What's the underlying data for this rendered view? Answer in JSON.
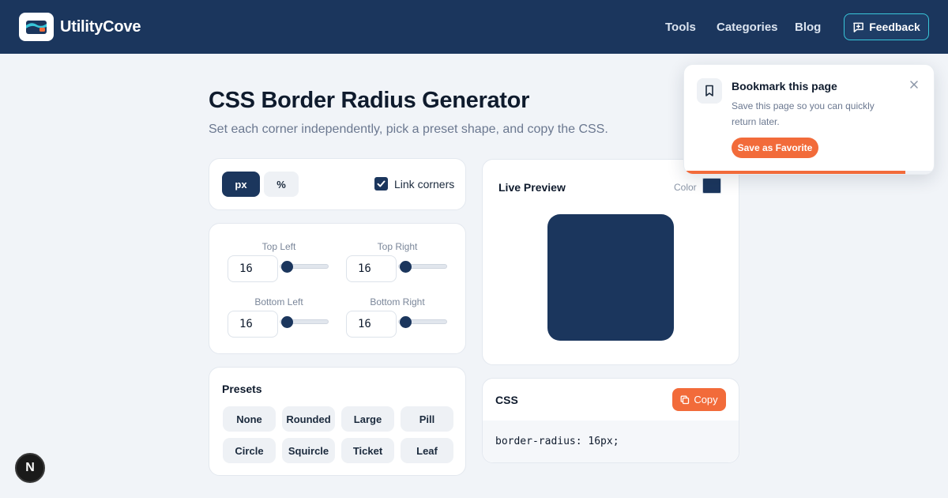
{
  "header": {
    "brand": "UtilityCove",
    "nav": [
      "Tools",
      "Categories",
      "Blog"
    ],
    "feedback_label": "Feedback"
  },
  "page": {
    "title": "CSS Border Radius Generator",
    "subtitle": "Set each corner independently, pick a preset shape, and copy the CSS."
  },
  "units": {
    "options": [
      "px",
      "%"
    ],
    "selected": "px",
    "link_corners_label": "Link corners",
    "link_corners_checked": true
  },
  "corners": {
    "top_left": {
      "label": "Top Left",
      "value": "16"
    },
    "top_right": {
      "label": "Top Right",
      "value": "16"
    },
    "bottom_left": {
      "label": "Bottom Left",
      "value": "16"
    },
    "bottom_right": {
      "label": "Bottom Right",
      "value": "16"
    }
  },
  "presets": {
    "title": "Presets",
    "items": [
      "None",
      "Rounded",
      "Large",
      "Pill",
      "Circle",
      "Squircle",
      "Ticket",
      "Leaf"
    ]
  },
  "preview": {
    "title": "Live Preview",
    "color_label": "Color",
    "color": "#1b365d"
  },
  "css_output": {
    "title": "CSS",
    "copy_label": "Copy",
    "code": "border-radius: 16px;"
  },
  "toast": {
    "title": "Bookmark this page",
    "text": "Save this page so you can quickly return later.",
    "button_label": "Save as Favorite",
    "progress": 0.88
  },
  "badge": {
    "letter": "N"
  },
  "colors": {
    "header_bg": "#1b365d",
    "accent": "#f26b3a",
    "feedback_border": "#38c6d9",
    "page_bg": "#f1f4f8"
  }
}
